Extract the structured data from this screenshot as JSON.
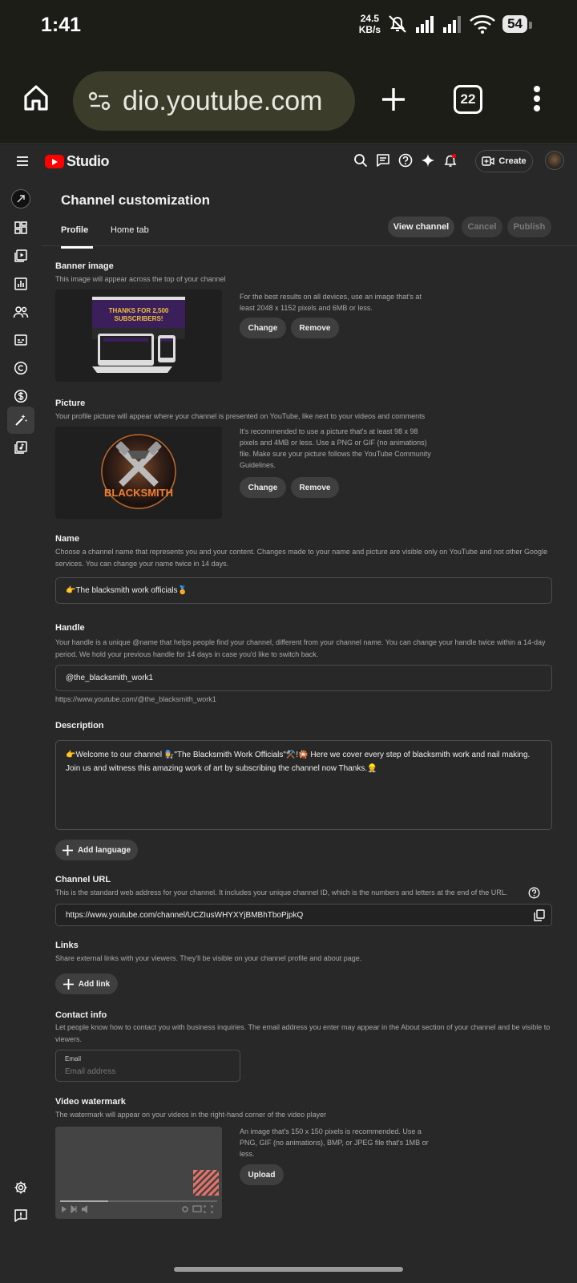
{
  "status_bar": {
    "time": "1:41",
    "speed_value": "24.5",
    "speed_unit": "KB/s",
    "battery": "54"
  },
  "browser": {
    "url": "dio.youtube.com",
    "tab_count": "22"
  },
  "studio": {
    "logo_text": "Studio",
    "create_label": "Create"
  },
  "page": {
    "title": "Channel customization",
    "tabs": [
      {
        "label": "Profile"
      },
      {
        "label": "Home tab"
      }
    ],
    "view_channel": "View channel",
    "cancel": "Cancel",
    "publish": "Publish"
  },
  "banner": {
    "title": "Banner image",
    "desc": "This image will appear across the top of your channel",
    "info": "For the best results on all devices, use an image that's at least 2048 x 1152 pixels and 6MB or less.",
    "change": "Change",
    "remove": "Remove",
    "preview_text_1": "THANKS FOR 2,500",
    "preview_text_2": "SUBSCRIBERS!"
  },
  "picture": {
    "title": "Picture",
    "desc": "Your profile picture will appear where your channel is presented on YouTube, like next to your videos and comments",
    "info": "It's recommended to use a picture that's at least 98 x 98 pixels and 4MB or less. Use a PNG or GIF (no animations) file. Make sure your picture follows the YouTube Community Guidelines.",
    "change": "Change",
    "remove": "Remove",
    "logo_text": "BLACKSMITH"
  },
  "name": {
    "title": "Name",
    "desc": "Choose a channel name that represents you and your content. Changes made to your name and picture are visible only on YouTube and not other Google services. You can change your name twice in 14 days.",
    "value": "👉The blacksmith work officials🏅"
  },
  "handle": {
    "title": "Handle",
    "desc": "Your handle is a unique @name that helps people find your channel, different from your channel name. You can change your handle twice within a 14-day period. We hold your previous handle for 14 days in case you'd like to switch back.",
    "value": "@the_blacksmith_work1",
    "url": "https://www.youtube.com/@the_blacksmith_work1"
  },
  "description": {
    "title": "Description",
    "value": "👉Welcome to our channel 👩‍🔧\"The Blacksmith Work Officials\"⚒️!🎇 Here we cover every step of blacksmith work and nail making. Join us and witness this amazing work of art by subscribing the channel now Thanks.👷",
    "add_language": "Add language"
  },
  "channel_url": {
    "title": "Channel URL",
    "desc": "This is the standard web address for your channel. It includes your unique channel ID, which is the numbers and letters at the end of the URL.",
    "value": "https://www.youtube.com/channel/UCZIusWHYXYjBMBhTboPjpkQ"
  },
  "links": {
    "title": "Links",
    "desc": "Share external links with your viewers. They'll be visible on your channel profile and about page.",
    "add_link": "Add link"
  },
  "contact": {
    "title": "Contact info",
    "desc": "Let people know how to contact you with business inquiries. The email address you enter may appear in the About section of your channel and be visible to viewers.",
    "email_label": "Email",
    "email_placeholder": "Email address"
  },
  "watermark": {
    "title": "Video watermark",
    "desc": "The watermark will appear on your videos in the right-hand corner of the video player",
    "info": "An image that's 150 x 150 pixels is recommended. Use a PNG, GIF (no animations), BMP, or JPEG file that's 1MB or less.",
    "upload": "Upload"
  }
}
